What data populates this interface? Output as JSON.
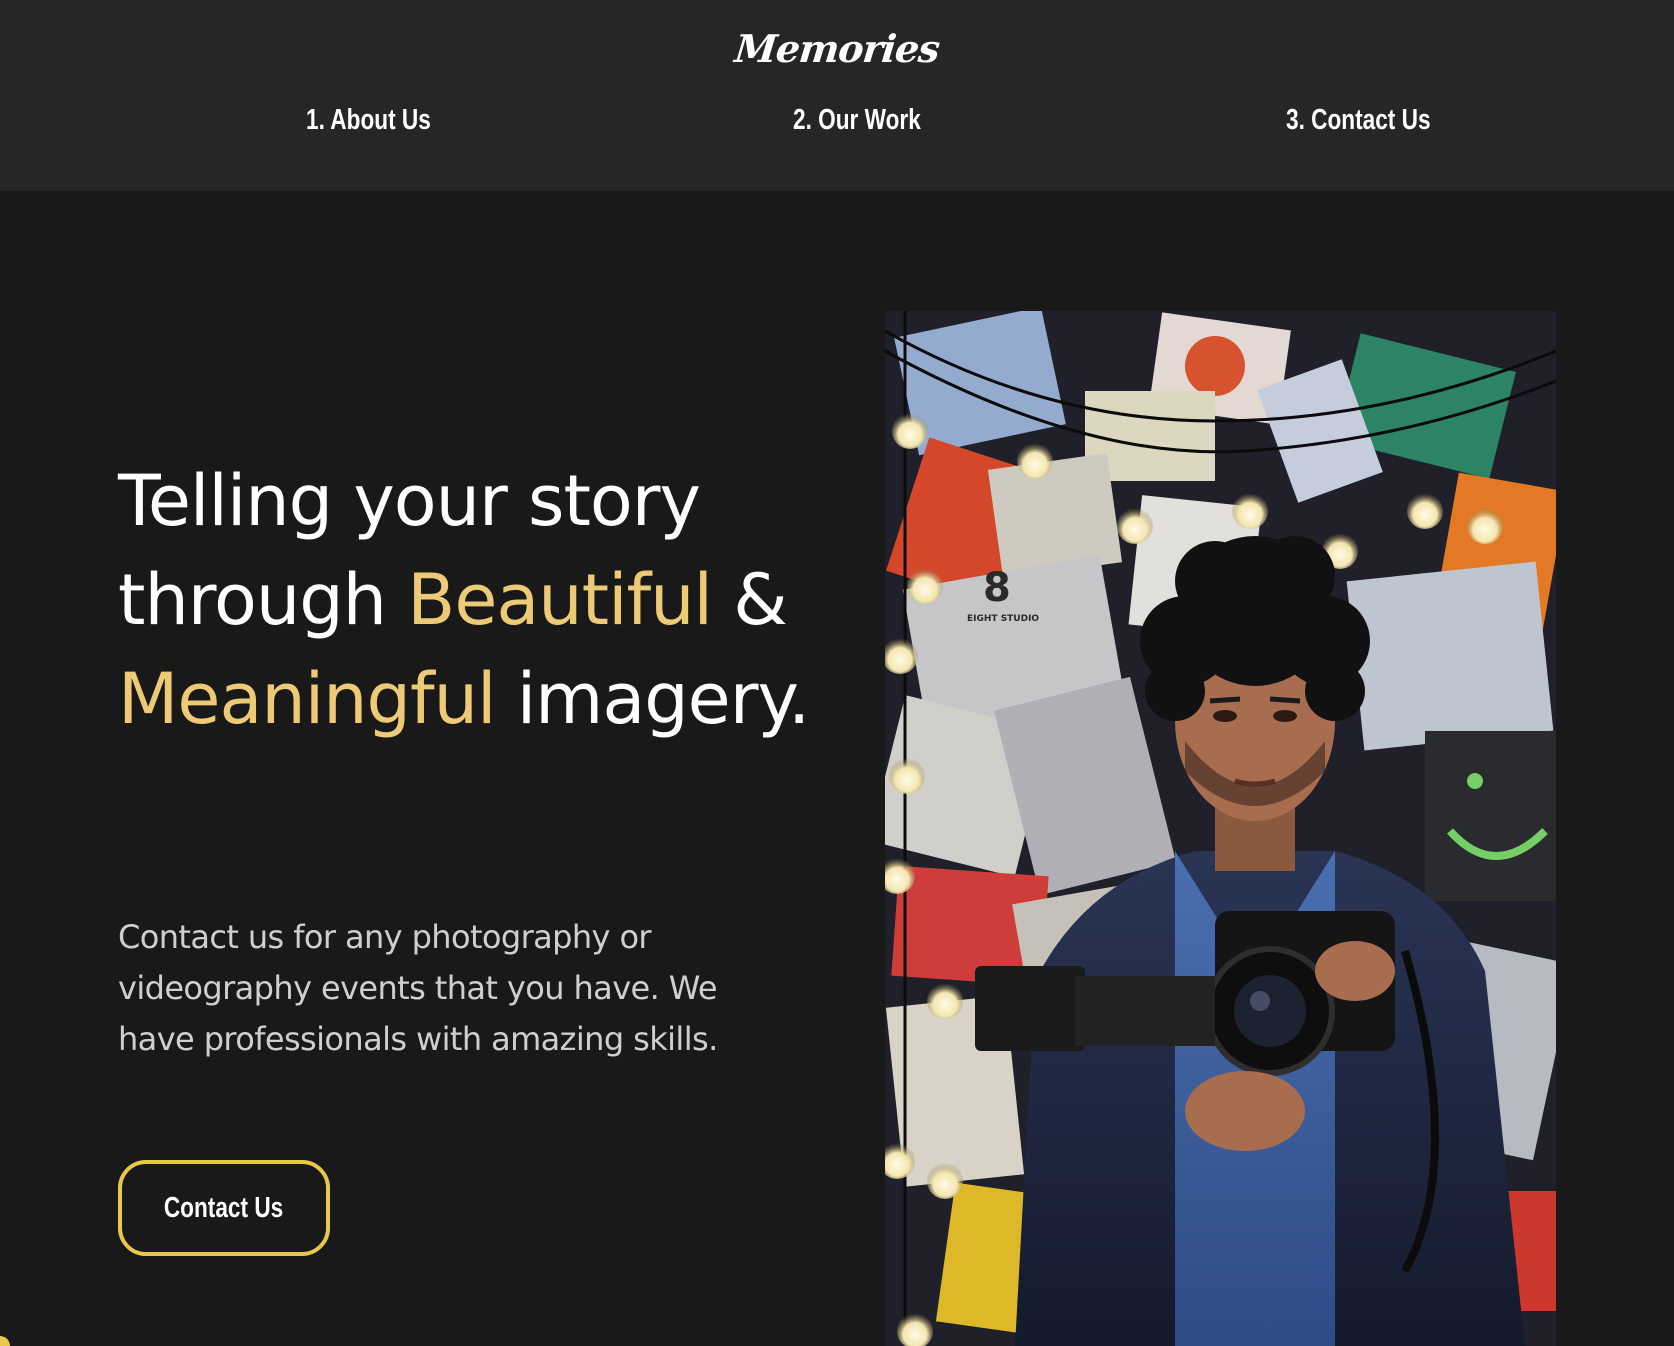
{
  "brand": {
    "logo_text": "Memories"
  },
  "nav": {
    "items": [
      {
        "label": "1. About Us"
      },
      {
        "label": "2. Our Work"
      },
      {
        "label": "3. Contact Us"
      }
    ]
  },
  "hero": {
    "title": {
      "part1": "Telling your story through ",
      "accent1": "Beautiful",
      "part2": " & ",
      "accent2": "Meaningful",
      "part3": " imagery."
    },
    "body": "Contact us for any photography or videography events that you have. We have professionals with amazing skills.",
    "cta_label": "Contact Us",
    "photo": {
      "watermark_digit": "8",
      "watermark_text": "EIGHT STUDIO"
    }
  },
  "colors": {
    "background": "#19191a",
    "header": "#262627",
    "accent": "#ecca76",
    "button_border": "#e7c84a",
    "text": "#ffffff",
    "body_text": "#cfcfcf"
  }
}
